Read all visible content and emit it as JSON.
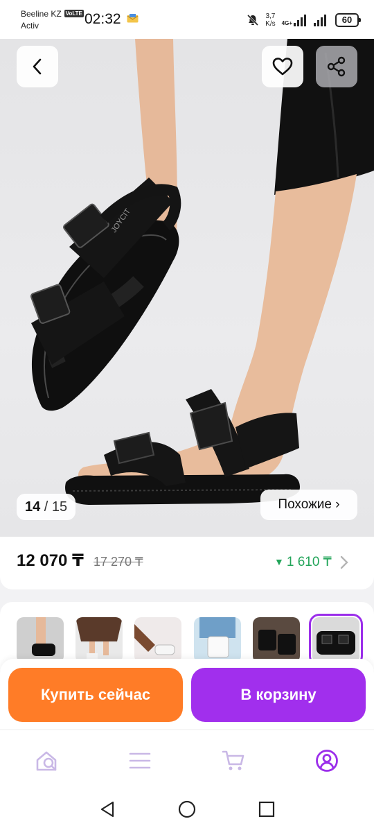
{
  "status_bar": {
    "carrier": "Beeline KZ",
    "carrier_sub": "Activ",
    "volte": "VoLTE",
    "time": "02:32",
    "speed_value": "3,7",
    "speed_unit": "K/s",
    "network": "4G+",
    "battery": "60"
  },
  "photo": {
    "current_index": "14",
    "separator": " / ",
    "total": "15",
    "similar_label": "Похожие ›",
    "brand_text": "JOYCIT"
  },
  "price_block": {
    "price": "12 070 ₸",
    "old_price": "17 270 ₸",
    "discount_marker": "▼",
    "discount": "1 610 ₸"
  },
  "actions": {
    "buy_now": "Купить сейчас",
    "add_to_cart": "В корзину"
  },
  "colors": {
    "buy_button": "#ff7c27",
    "cart_button": "#a12fed",
    "discount_green": "#23a55a",
    "active_nav": "#9b2eea",
    "inactive_nav": "#c9b8e6"
  },
  "icons": {
    "back": "chevron-left-icon",
    "favorite": "heart-icon",
    "share": "share-icon",
    "nav": [
      "search-home-icon",
      "catalog-icon",
      "cart-icon",
      "profile-icon"
    ],
    "system": [
      "back-triangle-icon",
      "home-circle-icon",
      "recents-square-icon"
    ]
  }
}
